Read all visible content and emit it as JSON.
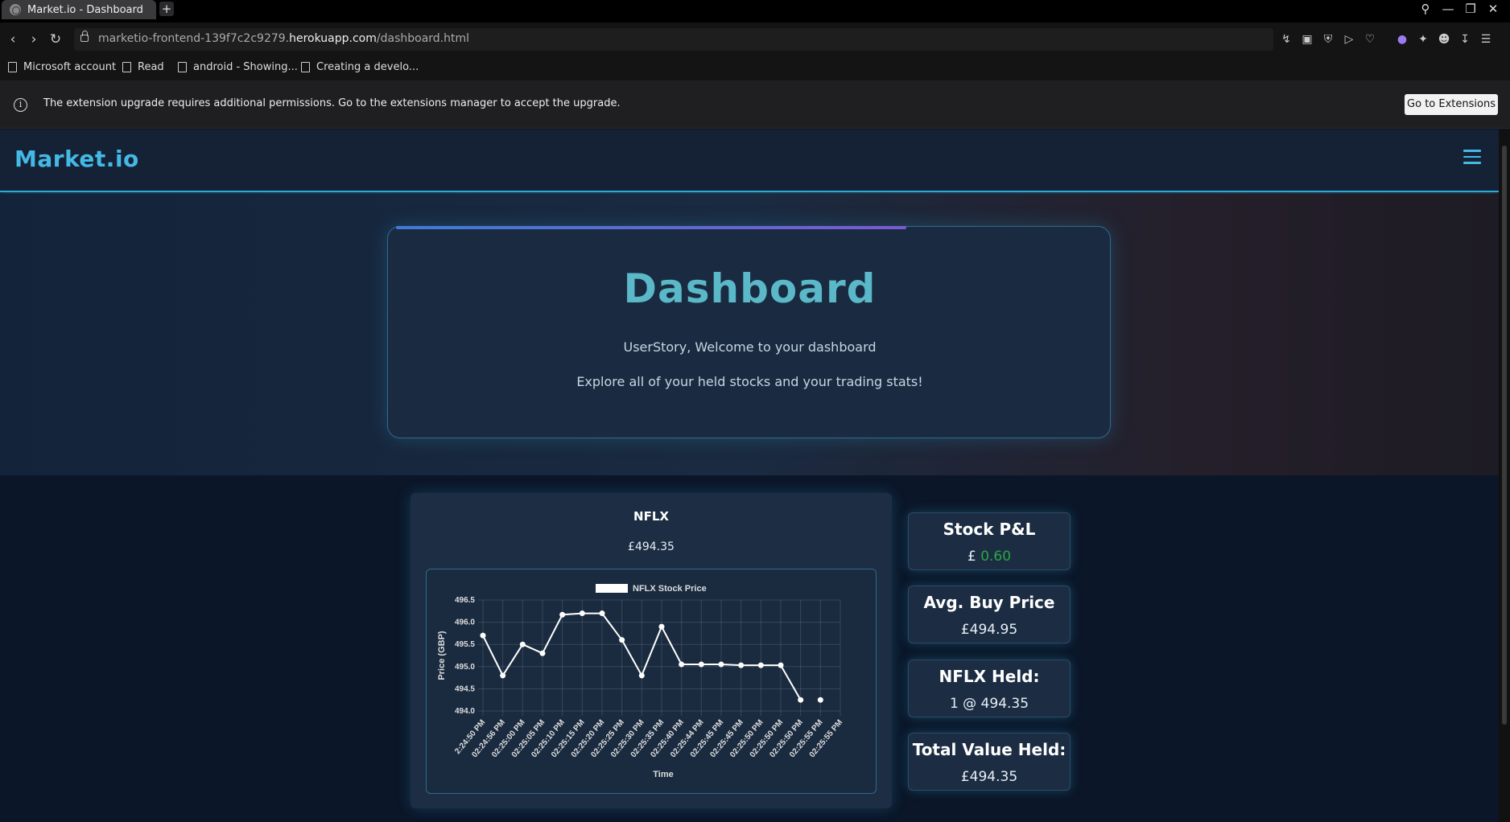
{
  "browser": {
    "tab_title": "Market.io - Dashboard",
    "new_tab_symbol": "+",
    "url_prefix": "marketio-frontend-139f7c2c9279.",
    "url_host": "herokuapp.com",
    "url_path": "/dashboard.html",
    "bookmarks": [
      "Microsoft account",
      "Read",
      "android - Showing...",
      "Creating a develo..."
    ],
    "infobar_text": "The extension upgrade requires additional permissions. Go to the extensions manager to accept the upgrade.",
    "infobar_button": "Go to Extensions"
  },
  "site": {
    "logo": "Market.io"
  },
  "hero": {
    "title": "Dashboard",
    "welcome": "UserStory, Welcome to your dashboard",
    "subtitle": "Explore all of your held stocks and your trading stats!"
  },
  "stock": {
    "symbol": "NFLX",
    "price": "£494.35"
  },
  "stats": {
    "pnl_title": "Stock P&L",
    "pnl_currency": "£",
    "pnl_value": "0.60",
    "avg_title": "Avg. Buy Price",
    "avg_value": "£494.95",
    "held_title": "NFLX Held:",
    "held_value": "1 @ 494.35",
    "total_title": "Total Value Held:",
    "total_value": "£494.35"
  },
  "colors": {
    "accent": "#44b9e6",
    "positive": "#28a745",
    "line": "#ffffff"
  },
  "chart_data": {
    "type": "line",
    "legend": "NFLX Stock Price",
    "xlabel": "Time",
    "ylabel": "Price (GBP)",
    "ylim": [
      494.0,
      496.5
    ],
    "yticks": [
      "496.5",
      "496.0",
      "495.5",
      "495.0",
      "494.5",
      "494.0"
    ],
    "x": [
      "2:24:50 PM",
      "02:24:56 PM",
      "02:25:00 PM",
      "02:25:05 PM",
      "02:25:10 PM",
      "02:25:15 PM",
      "02:25:20 PM",
      "02:25:25 PM",
      "02:25:30 PM",
      "02:25:35 PM",
      "02:25:40 PM",
      "02:25:44 PM",
      "02:25:45 PM",
      "02:25:45 PM",
      "02:25:50 PM",
      "02:25:50 PM",
      "02:25:50 PM",
      "02:25:55 PM",
      "02:25:55 PM"
    ],
    "series": [
      {
        "name": "NFLX Stock Price",
        "values": [
          495.7,
          494.8,
          495.5,
          495.3,
          496.17,
          496.2,
          496.2,
          495.6,
          494.8,
          495.9,
          495.05,
          495.05,
          495.05,
          495.03,
          495.03,
          495.03,
          494.25,
          494.25,
          null
        ]
      }
    ],
    "grid": true,
    "legend_position": "top-center"
  }
}
